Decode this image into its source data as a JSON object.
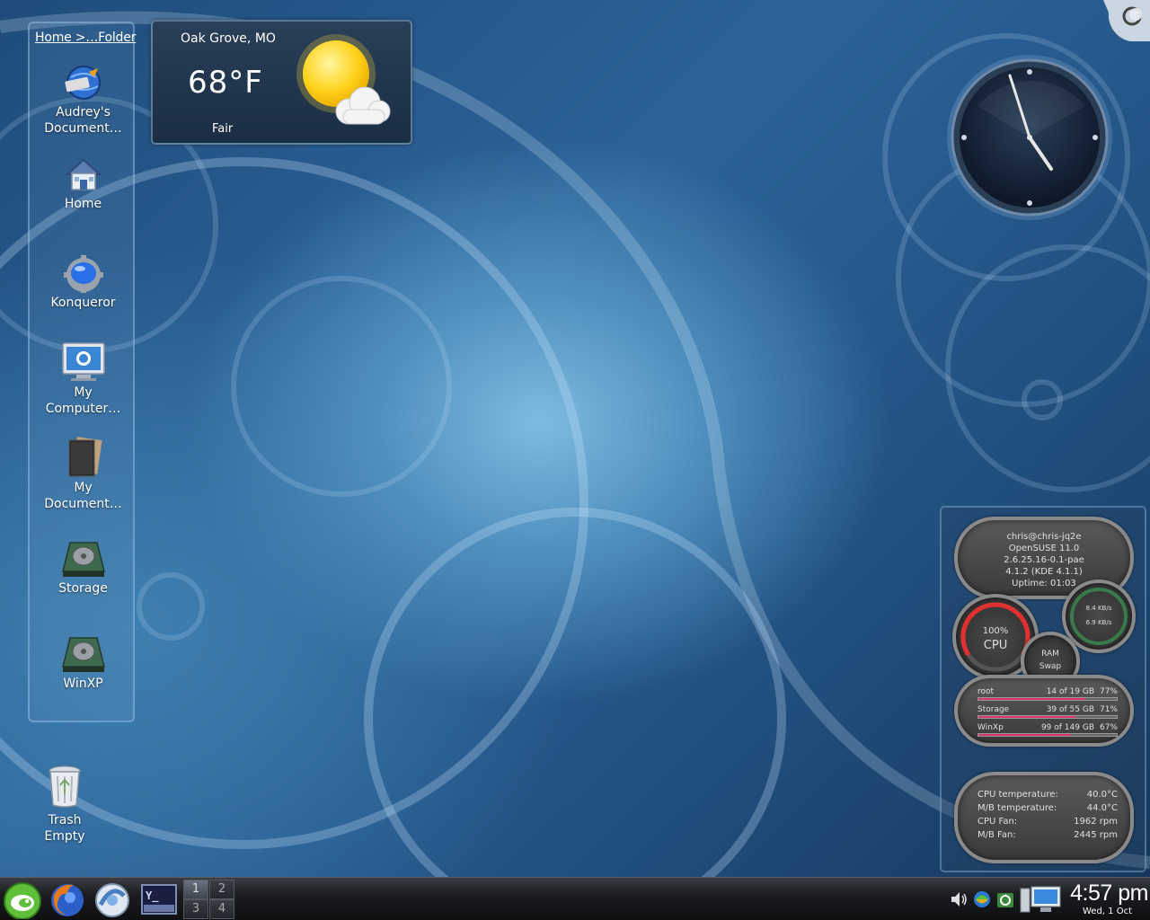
{
  "folderview": {
    "title_link": "Home >…Folder",
    "items": [
      {
        "label1": "Audrey's",
        "label2": "Document…",
        "icon": "globe-document-icon"
      },
      {
        "label1": "Home",
        "label2": "",
        "icon": "home-icon"
      },
      {
        "label1": "Konqueror",
        "label2": "",
        "icon": "konqueror-icon"
      },
      {
        "label1": "My",
        "label2": "Computer…",
        "icon": "computer-icon"
      },
      {
        "label1": "My",
        "label2": "Document…",
        "icon": "documents-icon"
      },
      {
        "label1": "Storage",
        "label2": "",
        "icon": "drive-icon"
      },
      {
        "label1": "WinXP",
        "label2": "",
        "icon": "drive-icon"
      }
    ]
  },
  "weather": {
    "location": "Oak Grove, MO",
    "temperature": "68°F",
    "condition": "Fair"
  },
  "trash": {
    "label1": "Trash",
    "label2": "Empty"
  },
  "sysmon": {
    "info": [
      "chris@chris-jq2e",
      "OpenSUSE 11.0",
      "2.6.25.16-0.1-pae",
      "4.1.2 (KDE 4.1.1)",
      "Uptime: 01:03"
    ],
    "cpu": {
      "value": "100%",
      "label": "CPU",
      "level": 1.0
    },
    "net": {
      "down": "8.4 KB/s",
      "up": "6.9 KB/s"
    },
    "ram": {
      "label1": "RAM",
      "label2": "Swap"
    },
    "disks": [
      {
        "name": "root",
        "usage": "14 of 19 GB",
        "percent": "77%",
        "fill": 0.77
      },
      {
        "name": "Storage",
        "usage": "39 of 55 GB",
        "percent": "71%",
        "fill": 0.71
      },
      {
        "name": "WinXp",
        "usage": "99 of 149 GB",
        "percent": "67%",
        "fill": 0.67
      }
    ],
    "temps": [
      {
        "key": "CPU temperature:",
        "value": "40.0°C"
      },
      {
        "key": "M/B temperature:",
        "value": "44.0°C"
      },
      {
        "key": "CPU Fan:",
        "value": "1962 rpm"
      },
      {
        "key": "M/B Fan:",
        "value": "2445 rpm"
      }
    ]
  },
  "taskbar": {
    "pager": [
      "1",
      "2",
      "3",
      "4"
    ],
    "time": "4:57 pm",
    "date": "Wed, 1 Oct"
  },
  "colors": {
    "accent": "#d9336c",
    "panel": "#1a2d44"
  }
}
